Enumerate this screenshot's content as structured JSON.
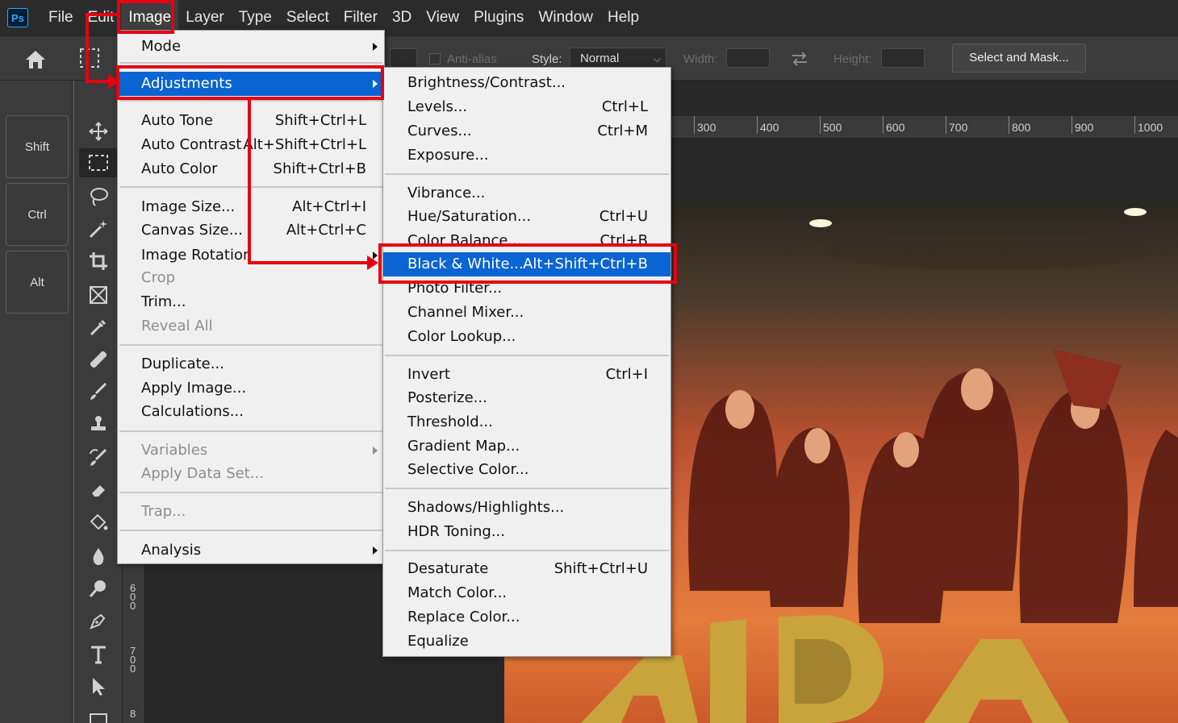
{
  "app": {
    "logo_text": "Ps"
  },
  "menubar": {
    "items": [
      "File",
      "Edit",
      "Image",
      "Layer",
      "Type",
      "Select",
      "Filter",
      "3D",
      "View",
      "Plugins",
      "Window",
      "Help"
    ],
    "active": "Image"
  },
  "options_bar": {
    "anti_alias_label": "Anti-alias",
    "style_label": "Style:",
    "style_value": "Normal",
    "width_label": "Width:",
    "height_label": "Height:",
    "select_and_mask_label": "Select and Mask..."
  },
  "modifier_keys": [
    "Shift",
    "Ctrl",
    "Alt"
  ],
  "tools": [
    "move-tool",
    "marquee-tool",
    "lasso-tool",
    "magic-wand-tool",
    "crop-tool",
    "frame-tool",
    "eyedropper-tool",
    "healing-brush-tool",
    "brush-tool",
    "clone-stamp-tool",
    "history-brush-tool",
    "eraser-tool",
    "paint-bucket-tool",
    "blur-tool",
    "dodge-tool",
    "pen-tool",
    "type-tool",
    "path-selection-tool",
    "rectangle-tool"
  ],
  "ruler_top_ticks": [
    "300",
    "400",
    "500",
    "600",
    "700",
    "800",
    "900",
    "1000"
  ],
  "ruler_left_ticks": [
    "600",
    "700",
    "8"
  ],
  "image_menu": {
    "items": [
      {
        "label": "Mode",
        "submenu": true
      },
      {
        "label": "Adjustments",
        "submenu": true,
        "highlighted": true
      },
      {
        "label": "Auto Tone",
        "shortcut": "Shift+Ctrl+L"
      },
      {
        "label": "Auto Contrast",
        "shortcut": "Alt+Shift+Ctrl+L"
      },
      {
        "label": "Auto Color",
        "shortcut": "Shift+Ctrl+B"
      },
      {
        "label": "Image Size...",
        "shortcut": "Alt+Ctrl+I"
      },
      {
        "label": "Canvas Size...",
        "shortcut": "Alt+Ctrl+C"
      },
      {
        "label": "Image Rotation",
        "submenu": true
      },
      {
        "label": "Crop",
        "disabled": true
      },
      {
        "label": "Trim..."
      },
      {
        "label": "Reveal All",
        "disabled": true
      },
      {
        "label": "Duplicate..."
      },
      {
        "label": "Apply Image..."
      },
      {
        "label": "Calculations..."
      },
      {
        "label": "Variables",
        "submenu": true,
        "disabled": true
      },
      {
        "label": "Apply Data Set...",
        "disabled": true
      },
      {
        "label": "Trap...",
        "disabled": true
      },
      {
        "label": "Analysis",
        "submenu": true
      }
    ]
  },
  "adjustments_menu": {
    "items": [
      {
        "label": "Brightness/Contrast..."
      },
      {
        "label": "Levels...",
        "shortcut": "Ctrl+L"
      },
      {
        "label": "Curves...",
        "shortcut": "Ctrl+M"
      },
      {
        "label": "Exposure..."
      },
      {
        "label": "Vibrance..."
      },
      {
        "label": "Hue/Saturation...",
        "shortcut": "Ctrl+U"
      },
      {
        "label": "Color Balance...",
        "shortcut": "Ctrl+B"
      },
      {
        "label": "Black & White...",
        "shortcut": "Alt+Shift+Ctrl+B",
        "highlighted": true
      },
      {
        "label": "Photo Filter..."
      },
      {
        "label": "Channel Mixer..."
      },
      {
        "label": "Color Lookup..."
      },
      {
        "label": "Invert",
        "shortcut": "Ctrl+I"
      },
      {
        "label": "Posterize..."
      },
      {
        "label": "Threshold..."
      },
      {
        "label": "Gradient Map..."
      },
      {
        "label": "Selective Color..."
      },
      {
        "label": "Shadows/Highlights..."
      },
      {
        "label": "HDR Toning..."
      },
      {
        "label": "Desaturate",
        "shortcut": "Shift+Ctrl+U"
      },
      {
        "label": "Match Color..."
      },
      {
        "label": "Replace Color..."
      },
      {
        "label": "Equalize"
      }
    ]
  },
  "colors": {
    "highlight": "#0a64d2",
    "annotation_red": "#e60012"
  }
}
